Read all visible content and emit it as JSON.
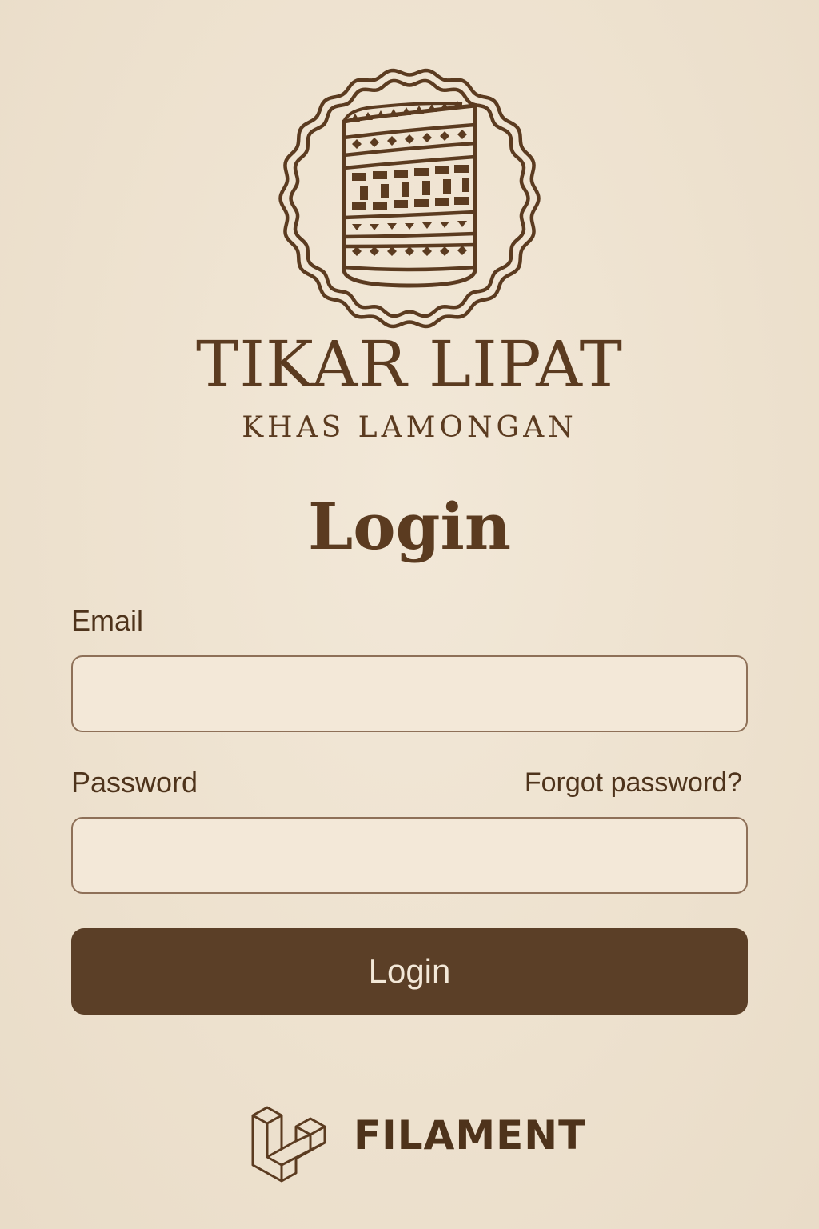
{
  "brand": {
    "title": "TIKAR LIPAT",
    "subtitle": "KHAS LAMONGAN",
    "emblem_icon": "folded-mat-emblem-icon"
  },
  "form": {
    "heading": "Login",
    "email": {
      "label": "Email",
      "value": "",
      "placeholder": ""
    },
    "password": {
      "label": "Password",
      "value": "",
      "placeholder": "",
      "forgot_link": "Forgot password?"
    },
    "submit_label": "Login"
  },
  "footer": {
    "brand_text": "FILAMENT",
    "logo_icon": "laravel-cube-logo-icon"
  },
  "colors": {
    "background": "#efe3d1",
    "primary": "#5b3f27",
    "text": "#4e331b",
    "input_border": "#8e7058"
  }
}
